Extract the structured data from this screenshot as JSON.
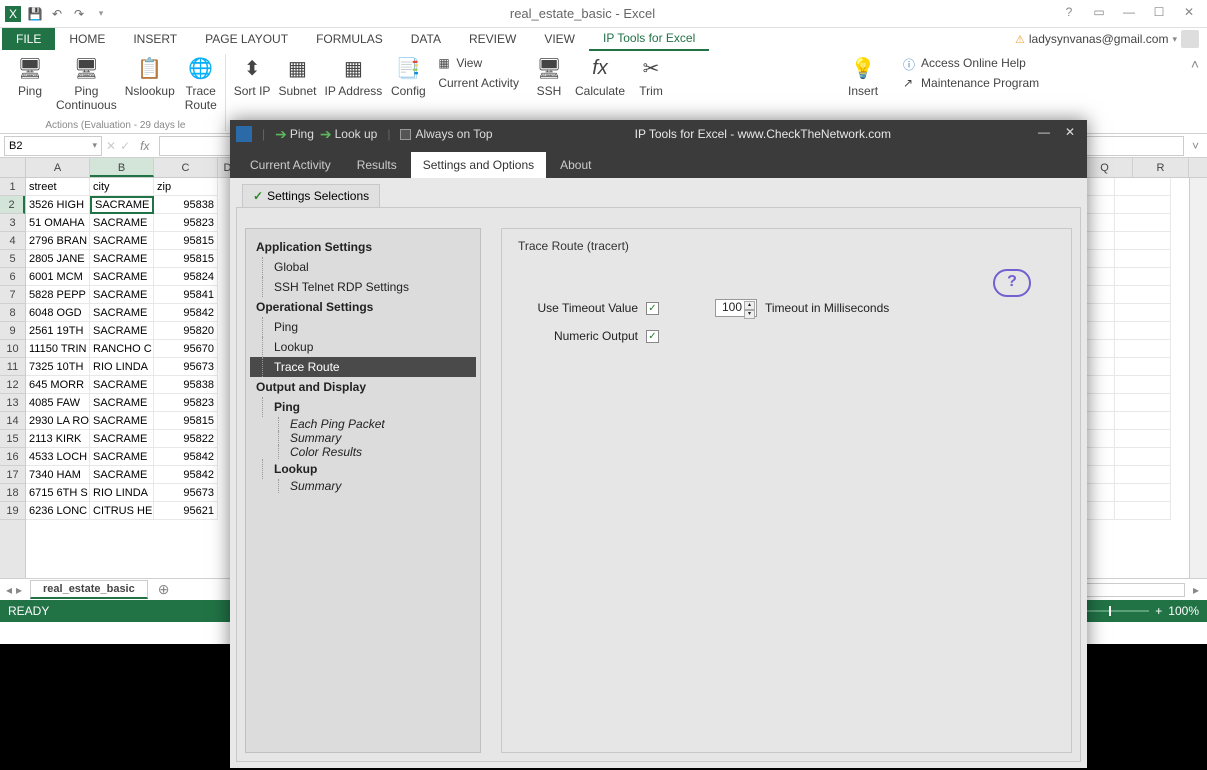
{
  "app": {
    "title": "real_estate_basic - Excel"
  },
  "user": {
    "email": "ladysynvanas@gmail.com"
  },
  "tabs": {
    "file": "FILE",
    "home": "HOME",
    "insert": "INSERT",
    "pagelayout": "PAGE LAYOUT",
    "formulas": "FORMULAS",
    "data": "DATA",
    "review": "REVIEW",
    "view": "VIEW",
    "iptools": "IP Tools for Excel"
  },
  "ribbon": {
    "ping": "Ping",
    "pingcont": "Ping\nContinuous",
    "nslookup": "Nslookup",
    "traceroute": "Trace\nRoute",
    "sortip": "Sort IP",
    "subnet": "Subnet",
    "ipaddress": "IP Address",
    "config": "Config",
    "viewca": "View",
    "currentactivity": "Current Activity",
    "ssh": "SSH",
    "calculate": "Calculate",
    "trim": "Trim",
    "insert": "Insert",
    "onlinehelp": "Access Online Help",
    "maintprog": "Maintenance Program",
    "group_actions": "Actions  (Evaluation - 29 days le"
  },
  "namebox": "B2",
  "columns": [
    "A",
    "B",
    "C",
    "D"
  ],
  "extracols": [
    "Q",
    "R"
  ],
  "headers": {
    "street": "street",
    "city": "city",
    "zip": "zip"
  },
  "rows": [
    {
      "n": "1",
      "a": "street",
      "b": "city",
      "c": "zip"
    },
    {
      "n": "2",
      "a": "3526 HIGH",
      "b": "SACRAME",
      "c": "95838"
    },
    {
      "n": "3",
      "a": "51 OMAHA",
      "b": "SACRAME",
      "c": "95823"
    },
    {
      "n": "4",
      "a": "2796 BRAN",
      "b": "SACRAME",
      "c": "95815"
    },
    {
      "n": "5",
      "a": "2805 JANE",
      "b": "SACRAME",
      "c": "95815"
    },
    {
      "n": "6",
      "a": "6001 MCM",
      "b": "SACRAME",
      "c": "95824"
    },
    {
      "n": "7",
      "a": "5828 PEPP",
      "b": "SACRAME",
      "c": "95841"
    },
    {
      "n": "8",
      "a": "6048 OGD",
      "b": "SACRAME",
      "c": "95842"
    },
    {
      "n": "9",
      "a": "2561 19TH",
      "b": "SACRAME",
      "c": "95820"
    },
    {
      "n": "10",
      "a": "11150 TRIN",
      "b": "RANCHO C",
      "c": "95670"
    },
    {
      "n": "11",
      "a": "7325 10TH",
      "b": "RIO LINDA",
      "c": "95673"
    },
    {
      "n": "12",
      "a": "645 MORR",
      "b": "SACRAME",
      "c": "95838"
    },
    {
      "n": "13",
      "a": "4085 FAW",
      "b": "SACRAME",
      "c": "95823"
    },
    {
      "n": "14",
      "a": "2930 LA RO",
      "b": "SACRAME",
      "c": "95815"
    },
    {
      "n": "15",
      "a": "2113 KIRK",
      "b": "SACRAME",
      "c": "95822"
    },
    {
      "n": "16",
      "a": "4533 LOCH",
      "b": "SACRAME",
      "c": "95842"
    },
    {
      "n": "17",
      "a": "7340 HAM",
      "b": "SACRAME",
      "c": "95842"
    },
    {
      "n": "18",
      "a": "6715 6TH S",
      "b": "RIO LINDA",
      "c": "95673"
    },
    {
      "n": "19",
      "a": "6236 LONC",
      "b": "CITRUS HE",
      "c": "95621"
    }
  ],
  "sheet": {
    "name": "real_estate_basic"
  },
  "status": {
    "ready": "READY",
    "zoom": "100%"
  },
  "dialog": {
    "title": "IP Tools for Excel - www.CheckTheNetwork.com",
    "pingbtn": "Ping",
    "lookupbtn": "Look up",
    "alwaysontop": "Always on Top",
    "tabs": {
      "current": "Current Activity",
      "results": "Results",
      "settings": "Settings and Options",
      "about": "About"
    },
    "subtab": "Settings Selections",
    "tree": {
      "appsettings": "Application Settings",
      "global": "Global",
      "sshtelnet": "SSH  Telnet  RDP Settings",
      "opsettings": "Operational Settings",
      "ping": "Ping",
      "lookup": "Lookup",
      "traceroute": "Trace Route",
      "output": "Output and Display",
      "oping": "Ping",
      "eachping": "Each Ping Packet",
      "summary": "Summary",
      "colorres": "Color Results",
      "olookup": "Lookup",
      "osummary": "Summary"
    },
    "panel": {
      "title": "Trace Route (tracert)",
      "usetimeout": "Use Timeout Value",
      "timeoutval": "100",
      "timeoutms": "Timeout in Milliseconds",
      "numout": "Numeric Output"
    }
  }
}
